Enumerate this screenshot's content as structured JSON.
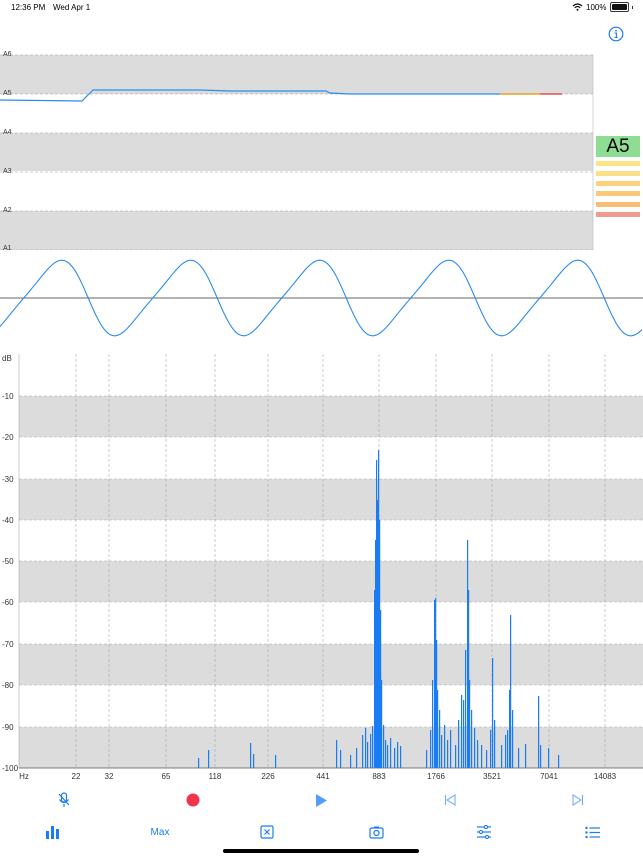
{
  "status_bar": {
    "time": "12:36 PM",
    "date": "Wed Apr 1",
    "battery": "100%"
  },
  "pitch": {
    "note_labels": [
      "A6",
      "A5",
      "A4",
      "A3",
      "A2",
      "A1"
    ],
    "current_note": "A5"
  },
  "spectrum": {
    "db_unit": "dB",
    "db_labels": [
      "-10",
      "-20",
      "-30",
      "-40",
      "-50",
      "-60",
      "-70",
      "-80",
      "-90",
      "-100"
    ],
    "hz_unit": "Hz",
    "hz_labels": [
      "22",
      "32",
      "65",
      "118",
      "226",
      "441",
      "883",
      "1766",
      "3521",
      "7041",
      "14083"
    ]
  },
  "toolbar_top": {
    "mic_icon": "mic-off-icon",
    "record_icon": "record-icon",
    "play_icon": "play-icon",
    "prev_icon": "skip-back-icon",
    "next_icon": "skip-forward-icon"
  },
  "toolbar_bottom": {
    "chart_icon": "bar-chart-icon",
    "max_label": "Max",
    "clear_icon": "clear-icon",
    "camera_icon": "camera-icon",
    "sliders_icon": "sliders-icon",
    "list_icon": "list-icon"
  },
  "colors": {
    "accent": "#1a7cf5",
    "record": "#f0334f",
    "note_good": "#8fdc93",
    "band": "#dcdcdc"
  }
}
